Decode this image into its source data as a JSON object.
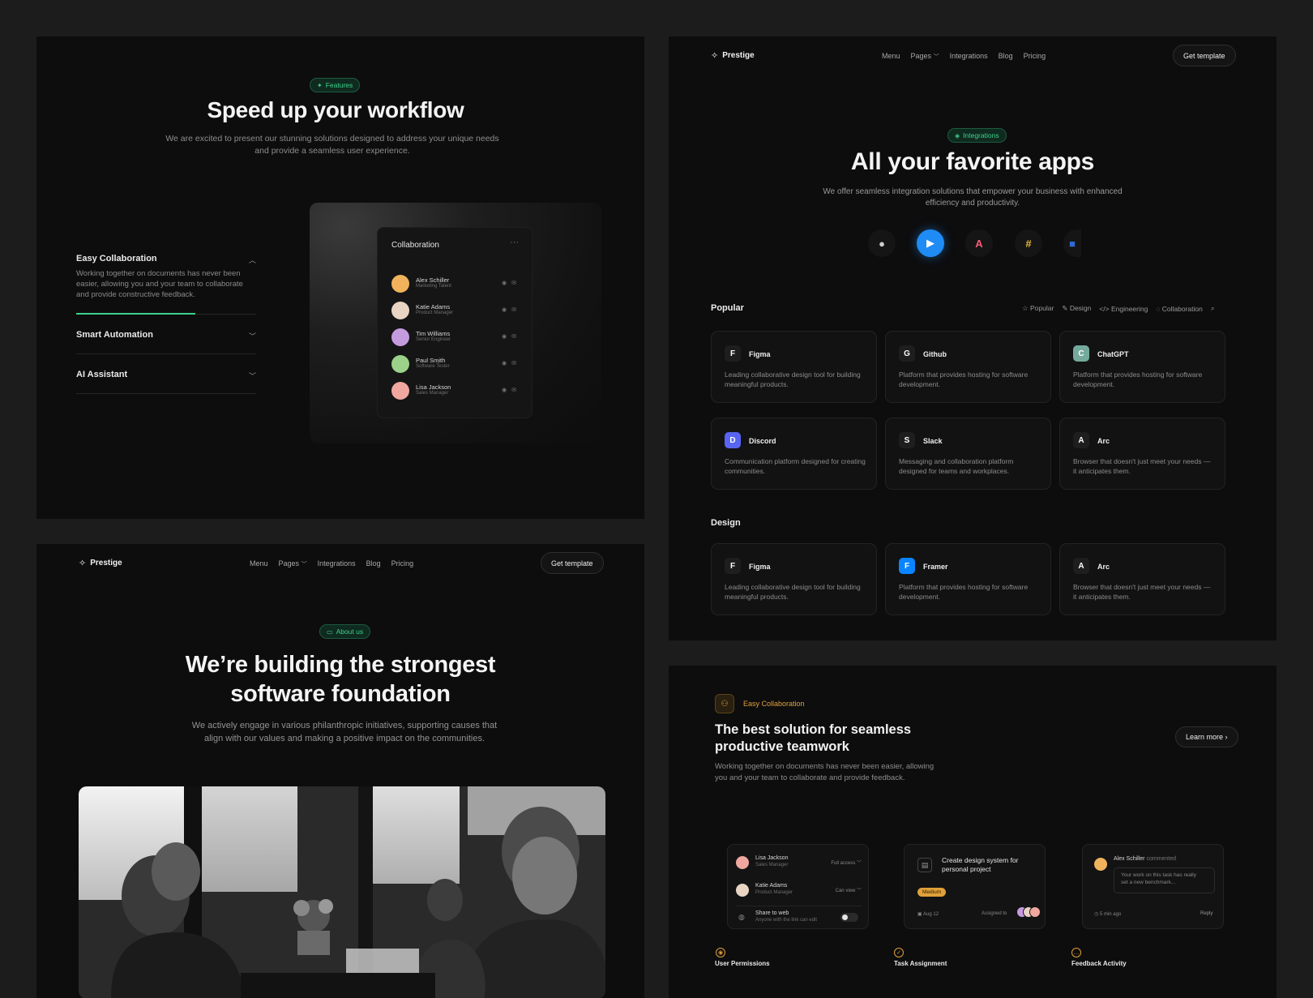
{
  "p1": {
    "badge": "Features",
    "title": "Speed up your workflow",
    "subtitle_l1": "We are excited to present our stunning solutions designed to address your unique needs",
    "subtitle_l2": "and provide a seamless user experience.",
    "accordion": [
      {
        "title": "Easy Collaboration",
        "body": "Working together on documents has never been easier, allowing you and your team to collaborate and provide constructive feedback.",
        "progress": 0.66
      },
      {
        "title": "Smart Automation"
      },
      {
        "title": "AI Assistant"
      }
    ],
    "collab": {
      "title": "Collaboration",
      "people": [
        {
          "name": "Alex Schiller",
          "role": "Marketing Talent",
          "color": "#f0b35c"
        },
        {
          "name": "Katie Adams",
          "role": "Product Manager",
          "color": "#e8d4c3"
        },
        {
          "name": "Tim Williams",
          "role": "Senior Engineer",
          "color": "#c59be0"
        },
        {
          "name": "Paul Smith",
          "role": "Software Tester",
          "color": "#9cd18a"
        },
        {
          "name": "Lisa Jackson",
          "role": "Sales Manager",
          "color": "#f0a7a0"
        }
      ]
    }
  },
  "nav": {
    "brand": "Prestige",
    "links": [
      "Menu",
      "Pages",
      "Integrations",
      "Blog",
      "Pricing"
    ],
    "cta": "Get template"
  },
  "p2": {
    "badge": "Integrations",
    "title": "All your favorite apps",
    "subtitle_l1": "We offer seamless integration solutions that empower your business with enhanced",
    "subtitle_l2": "efficiency and productivity.",
    "popular_title": "Popular",
    "filters": [
      "Popular",
      "Design",
      "Engineering",
      "Collaboration"
    ],
    "popular_cards": [
      {
        "name": "Figma",
        "desc": "Leading collaborative design tool for building meaningful products.",
        "color": "#1e1e1e"
      },
      {
        "name": "Github",
        "desc": "Platform that provides hosting for software development.",
        "color": "#1e1e1e"
      },
      {
        "name": "ChatGPT",
        "desc": "Platform that provides hosting for software development.",
        "color": "#74aa9c"
      },
      {
        "name": "Discord",
        "desc": "Communication platform designed for creating communities.",
        "color": "#5865f2"
      },
      {
        "name": "Slack",
        "desc": "Messaging and collaboration platform designed for teams and workplaces.",
        "color": "#1e1e1e"
      },
      {
        "name": "Arc",
        "desc": "Browser that doesn't just meet your needs — it anticipates them.",
        "color": "#1e1e1e"
      }
    ],
    "design_title": "Design",
    "design_cards": [
      {
        "name": "Figma",
        "desc": "Leading collaborative design tool for building meaningful products.",
        "color": "#1e1e1e"
      },
      {
        "name": "Framer",
        "desc": "Platform that provides hosting for software development.",
        "color": "#0a84ff"
      },
      {
        "name": "Arc",
        "desc": "Browser that doesn't just meet your needs — it anticipates them.",
        "color": "#1e1e1e"
      }
    ]
  },
  "p3": {
    "badge": "About us",
    "title_l1": "We’re building the strongest",
    "title_l2": "software foundation",
    "subtitle_l1": "We actively engage in various philanthropic initiatives, supporting causes that",
    "subtitle_l2": "align with our values and making a positive impact on the communities."
  },
  "p4": {
    "tag": "Easy Collaboration",
    "title_l1": "The best solution for seamless",
    "title_l2": "productive teamwork",
    "desc_l1": "Working together on documents has never been easier, allowing",
    "desc_l2": "you and your team to collaborate and provide feedback.",
    "cta": "Learn more",
    "perm": {
      "rows": [
        {
          "name": "Lisa Jackson",
          "role": "Sales Manager",
          "access": "Full access"
        },
        {
          "name": "Katie Adams",
          "role": "Product Manager",
          "access": "Can view"
        }
      ],
      "share_title": "Share to web",
      "share_sub": "Anyone with the link can edit"
    },
    "task": {
      "title_l1": "Create design system for",
      "title_l2": "personal project",
      "tag": "Medium",
      "date": "Aug 12",
      "assigned": "Assigned to"
    },
    "comment": {
      "author": "Alex Schiller",
      "verb": "commented",
      "text_l1": "Your work on this task has really",
      "text_l2": "set a new benchmark...",
      "time": "5 min ago",
      "reply": "Reply"
    },
    "features": [
      "User Permissions",
      "Task Assignment",
      "Feedback Activity"
    ]
  }
}
